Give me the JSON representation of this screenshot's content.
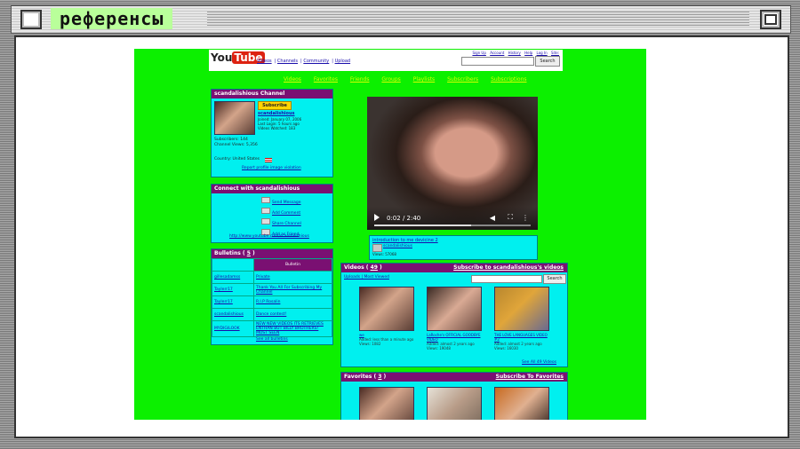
{
  "window": {
    "title": "референсы"
  },
  "youtube": {
    "logo": "YouTube",
    "nav": [
      "Videos",
      "Channels",
      "Community",
      "Upload"
    ],
    "user_links": [
      "Sign Up",
      "Account",
      "History",
      "Help",
      "Log In",
      "Site:"
    ],
    "search_button": "Search"
  },
  "channel_nav": [
    "Videos",
    "Favorites",
    "Friends",
    "Groups",
    "Playlists",
    "Subscribers",
    "Subscriptions"
  ],
  "channel_box": {
    "title": "scandalishious Channel",
    "subscribe": "Subscribe",
    "username": "scandalishious",
    "joined": "Joined: January 07, 2006",
    "last_login": "Last Login: 5 hours ago",
    "videos_watched": "Videos Watched: 183",
    "subscribers": "Subscribers: 144",
    "views": "Channel Views: 5,356",
    "country": "Country: United States",
    "report": "Report profile image violation"
  },
  "connect_box": {
    "title": "Connect with scandalishious",
    "actions": [
      "Send Message",
      "Add Comment",
      "Share Channel",
      "Add as Friend"
    ],
    "url": "http://www.youtube.com/scandalishious"
  },
  "bulletins": {
    "title": "Bulletins",
    "count": "5",
    "header": "Bulletin",
    "authors": [
      "gillesadamss",
      "Taylerr17",
      "Taylerr17",
      "scandalishious",
      "MYDIGILOOK"
    ],
    "items": [
      "Private",
      "Thank You All For Subscribing My Channel",
      "R.I.P Rosalin",
      "Dance contest!",
      "NEW NEW VIDEOS ITS RETRIEVES ENTHAN BUT BILLY BROTHERS! MOST SEEN"
    ],
    "see_all": "See all bulletins"
  },
  "video_player": {
    "time": "0:02 / 2:40"
  },
  "now_playing": {
    "title": "introduction to me devicine 2",
    "by": "scandalishious",
    "views": "Views: 57068"
  },
  "videos": {
    "title": "Videos",
    "count": "49",
    "subscribe_link": "Subscribe to scandalishious's videos",
    "tabs": "Uploads | Most Viewed",
    "search_button": "Search",
    "items": [
      {
        "title": "we",
        "meta": "Added: less than a minute ago",
        "views": "Views: 1082"
      },
      {
        "title": "LaRoche's OFFICIAL GOODBYE VIDEO",
        "meta": "Added: almost 2 years ago",
        "views": "Views: 19048"
      },
      {
        "title": "THE LOVE LANGUAGES VIDEO #2",
        "meta": "Added: almost 2 years ago",
        "views": "Views: 16030"
      }
    ],
    "see_all": "See All 49 Videos"
  },
  "favorites": {
    "title": "Favorites",
    "count": "3",
    "subscribe_link": "Subscribe To Favorites"
  },
  "colors": {
    "page_green": "#0cf000",
    "box_cyan": "#00f0ef",
    "header_purple": "#7a1072",
    "tab_yellow": "#d6ff00"
  }
}
